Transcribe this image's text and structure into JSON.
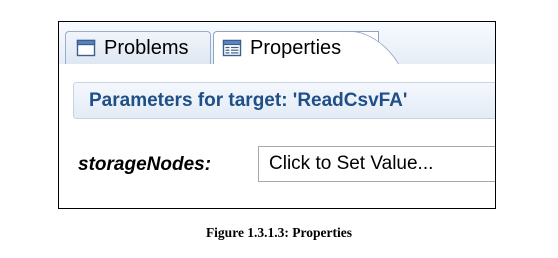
{
  "tabs": {
    "problems": {
      "label": "Problems",
      "icon": "problems-view-icon"
    },
    "properties": {
      "label": "Properties",
      "icon": "properties-view-icon",
      "active": true
    }
  },
  "panel": {
    "header": "Parameters for target: 'ReadCsvFA'",
    "field": {
      "label": "storageNodes:",
      "value": "Click to Set Value..."
    }
  },
  "caption": "Figure 1.3.1.3: Properties",
  "colors": {
    "header_text": "#1f4f86",
    "tab_border": "#8fa3c2",
    "header_bg": "#e3ebf6"
  }
}
